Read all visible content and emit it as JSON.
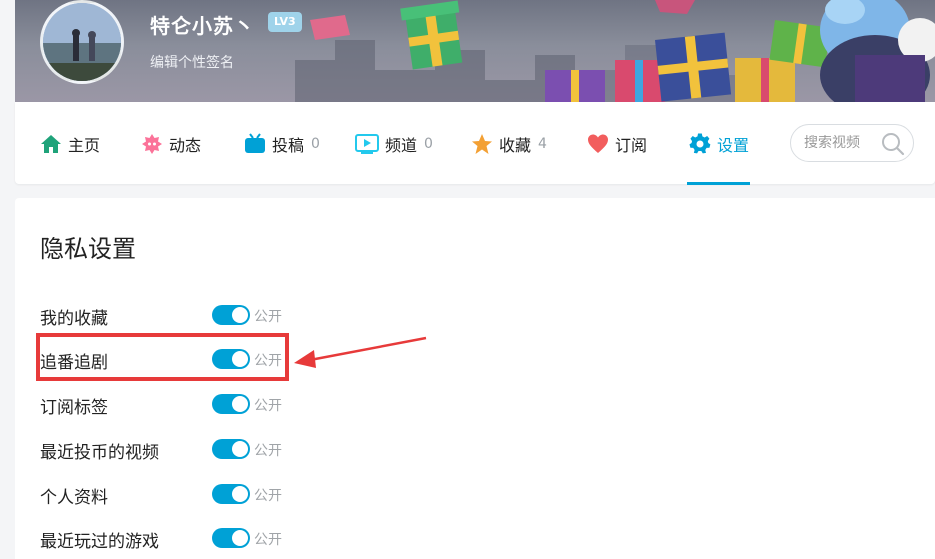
{
  "profile": {
    "username": "特仑小苏丶",
    "level": "LV3",
    "signature_placeholder": "编辑个性签名"
  },
  "nav": {
    "items": [
      {
        "label": "主页",
        "count": "",
        "icon": "home-icon",
        "color": "#23ade5"
      },
      {
        "label": "动态",
        "count": "",
        "icon": "dynamic-icon",
        "color": "#fb7299"
      },
      {
        "label": "投稿",
        "count": "0",
        "icon": "tv-icon",
        "color": "#00a1d6"
      },
      {
        "label": "频道",
        "count": "0",
        "icon": "channel-icon",
        "color": "#23c9ed"
      },
      {
        "label": "收藏",
        "count": "4",
        "icon": "star-icon",
        "color": "#f3a034"
      },
      {
        "label": "订阅",
        "count": "",
        "icon": "heart-icon",
        "color": "#f25d5d"
      },
      {
        "label": "设置",
        "count": "",
        "icon": "gear-icon",
        "color": "#00a1d6"
      }
    ],
    "active": "设置",
    "search_placeholder": "搜索视频"
  },
  "privacy": {
    "title": "隐私设置",
    "rows": [
      {
        "label": "我的收藏",
        "state": "公开",
        "on": true
      },
      {
        "label": "追番追剧",
        "state": "公开",
        "on": true
      },
      {
        "label": "订阅标签",
        "state": "公开",
        "on": true
      },
      {
        "label": "最近投币的视频",
        "state": "公开",
        "on": true
      },
      {
        "label": "个人资料",
        "state": "公开",
        "on": true
      },
      {
        "label": "最近玩过的游戏",
        "state": "公开",
        "on": true
      }
    ]
  },
  "colors": {
    "accent": "#00a1d6",
    "annotation": "#e73a3a"
  }
}
